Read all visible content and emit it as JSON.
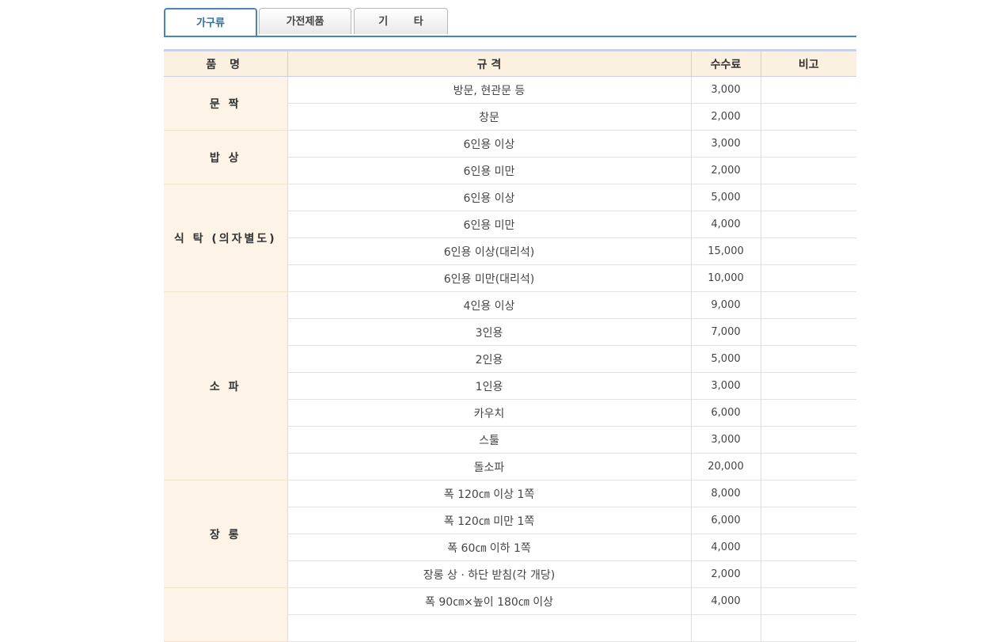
{
  "tabs": [
    {
      "label": "가구류",
      "active": true
    },
    {
      "label": "가전제품",
      "active": false
    },
    {
      "label": "기 타",
      "active": false
    }
  ],
  "table": {
    "headers": [
      "품 명",
      "규 격",
      "수수료",
      "비고"
    ],
    "groups": [
      {
        "item": "문 짝",
        "rows": [
          {
            "spec": "방문, 현관문 등",
            "fee": "3,000",
            "note": ""
          },
          {
            "spec": "창문",
            "fee": "2,000",
            "note": ""
          }
        ]
      },
      {
        "item": "밥 상",
        "rows": [
          {
            "spec": "6인용 이상",
            "fee": "3,000",
            "note": ""
          },
          {
            "spec": "6인용 미만",
            "fee": "2,000",
            "note": ""
          }
        ]
      },
      {
        "item": "식 탁 (의자별도)",
        "rows": [
          {
            "spec": "6인용 이상",
            "fee": "5,000",
            "note": ""
          },
          {
            "spec": "6인용 미만",
            "fee": "4,000",
            "note": ""
          },
          {
            "spec": "6인용 이상(대리석)",
            "fee": "15,000",
            "note": ""
          },
          {
            "spec": "6인용 미만(대리석)",
            "fee": "10,000",
            "note": ""
          }
        ]
      },
      {
        "item": "소 파",
        "rows": [
          {
            "spec": "4인용 이상",
            "fee": "9,000",
            "note": ""
          },
          {
            "spec": "3인용",
            "fee": "7,000",
            "note": ""
          },
          {
            "spec": "2인용",
            "fee": "5,000",
            "note": ""
          },
          {
            "spec": "1인용",
            "fee": "3,000",
            "note": ""
          },
          {
            "spec": "카우치",
            "fee": "6,000",
            "note": ""
          },
          {
            "spec": "스툴",
            "fee": "3,000",
            "note": ""
          },
          {
            "spec": "돌소파",
            "fee": "20,000",
            "note": ""
          }
        ]
      },
      {
        "item": "장 롱",
        "rows": [
          {
            "spec": "폭 120㎝ 이상 1쪽",
            "fee": "8,000",
            "note": ""
          },
          {
            "spec": "폭 120㎝ 미만 1쪽",
            "fee": "6,000",
            "note": ""
          },
          {
            "spec": "폭 60㎝ 이하 1쪽",
            "fee": "4,000",
            "note": ""
          },
          {
            "spec": "장롱 상 · 하단 받침(각 개당)",
            "fee": "2,000",
            "note": ""
          }
        ]
      },
      {
        "item": "",
        "rows": [
          {
            "spec": "폭 90㎝×높이 180㎝ 이상",
            "fee": "4,000",
            "note": ""
          },
          {
            "spec": "",
            "fee": "",
            "note": ""
          }
        ]
      }
    ]
  }
}
